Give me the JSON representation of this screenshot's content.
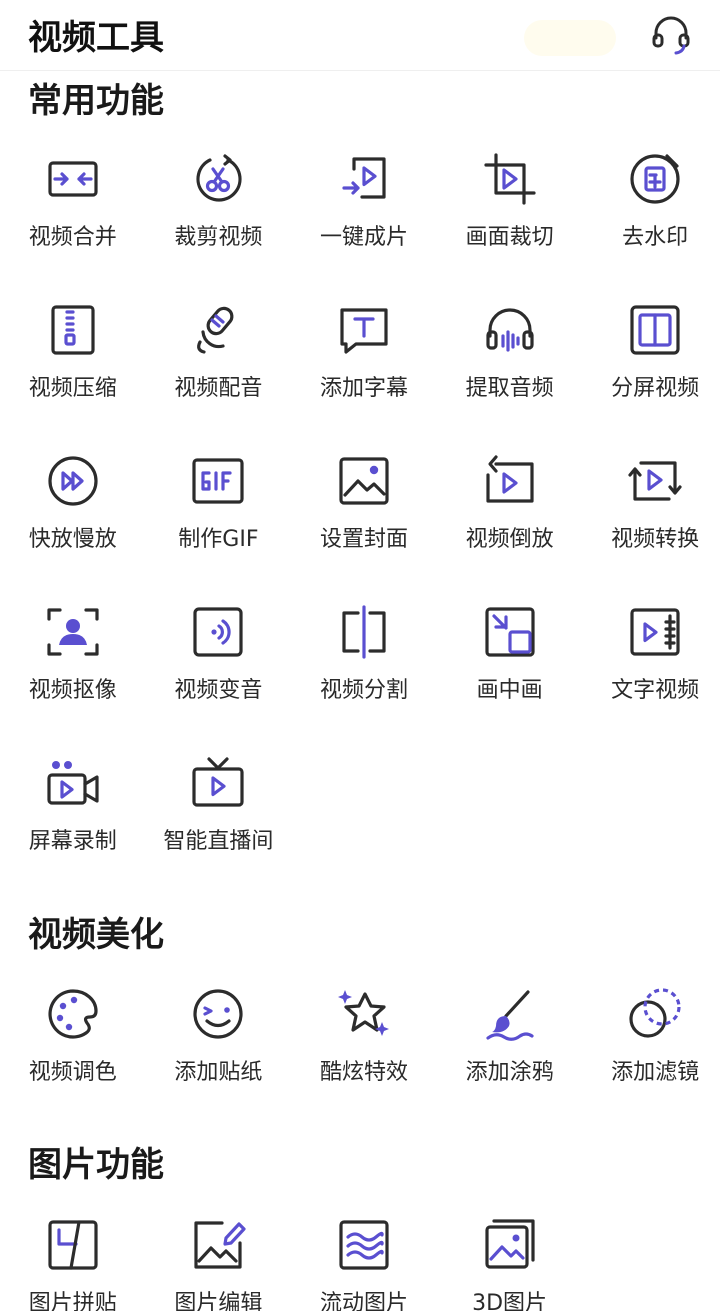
{
  "app": {
    "title": "视频工具",
    "support_icon": "headset-icon",
    "accent_color": "#5a4fd0",
    "ink_color": "#2c2c2c"
  },
  "sections": [
    {
      "title": "常用功能",
      "items": [
        {
          "label": "视频合并",
          "icon": "merge-icon"
        },
        {
          "label": "裁剪视频",
          "icon": "scissors-icon"
        },
        {
          "label": "一键成片",
          "icon": "one-click-movie-icon"
        },
        {
          "label": "画面裁切",
          "icon": "crop-icon"
        },
        {
          "label": "去水印",
          "icon": "stamp-icon"
        },
        {
          "label": "视频压缩",
          "icon": "zip-icon"
        },
        {
          "label": "视频配音",
          "icon": "microphone-icon"
        },
        {
          "label": "添加字幕",
          "icon": "subtitle-icon"
        },
        {
          "label": "提取音频",
          "icon": "headphones-icon"
        },
        {
          "label": "分屏视频",
          "icon": "split-screen-icon"
        },
        {
          "label": "快放慢放",
          "icon": "fast-forward-icon"
        },
        {
          "label": "制作GIF",
          "icon": "gif-icon"
        },
        {
          "label": "设置封面",
          "icon": "image-icon"
        },
        {
          "label": "视频倒放",
          "icon": "reverse-icon"
        },
        {
          "label": "视频转换",
          "icon": "convert-icon"
        },
        {
          "label": "视频抠像",
          "icon": "portrait-cutout-icon"
        },
        {
          "label": "视频变音",
          "icon": "voice-change-icon"
        },
        {
          "label": "视频分割",
          "icon": "split-icon"
        },
        {
          "label": "画中画",
          "icon": "picture-in-picture-icon"
        },
        {
          "label": "文字视频",
          "icon": "text-video-icon"
        },
        {
          "label": "屏幕录制",
          "icon": "screen-record-icon"
        },
        {
          "label": "智能直播间",
          "icon": "live-tv-icon"
        }
      ]
    },
    {
      "title": "视频美化",
      "items": [
        {
          "label": "视频调色",
          "icon": "palette-icon"
        },
        {
          "label": "添加贴纸",
          "icon": "sticker-face-icon"
        },
        {
          "label": "酷炫特效",
          "icon": "sparkle-star-icon"
        },
        {
          "label": "添加涂鸦",
          "icon": "brush-icon"
        },
        {
          "label": "添加滤镜",
          "icon": "filter-icon"
        }
      ]
    },
    {
      "title": "图片功能",
      "items": [
        {
          "label": "图片拼贴",
          "icon": "collage-icon"
        },
        {
          "label": "图片编辑",
          "icon": "image-edit-icon"
        },
        {
          "label": "流动图片",
          "icon": "flowing-image-icon"
        },
        {
          "label": "3D图片",
          "icon": "3d-image-icon"
        }
      ]
    }
  ]
}
